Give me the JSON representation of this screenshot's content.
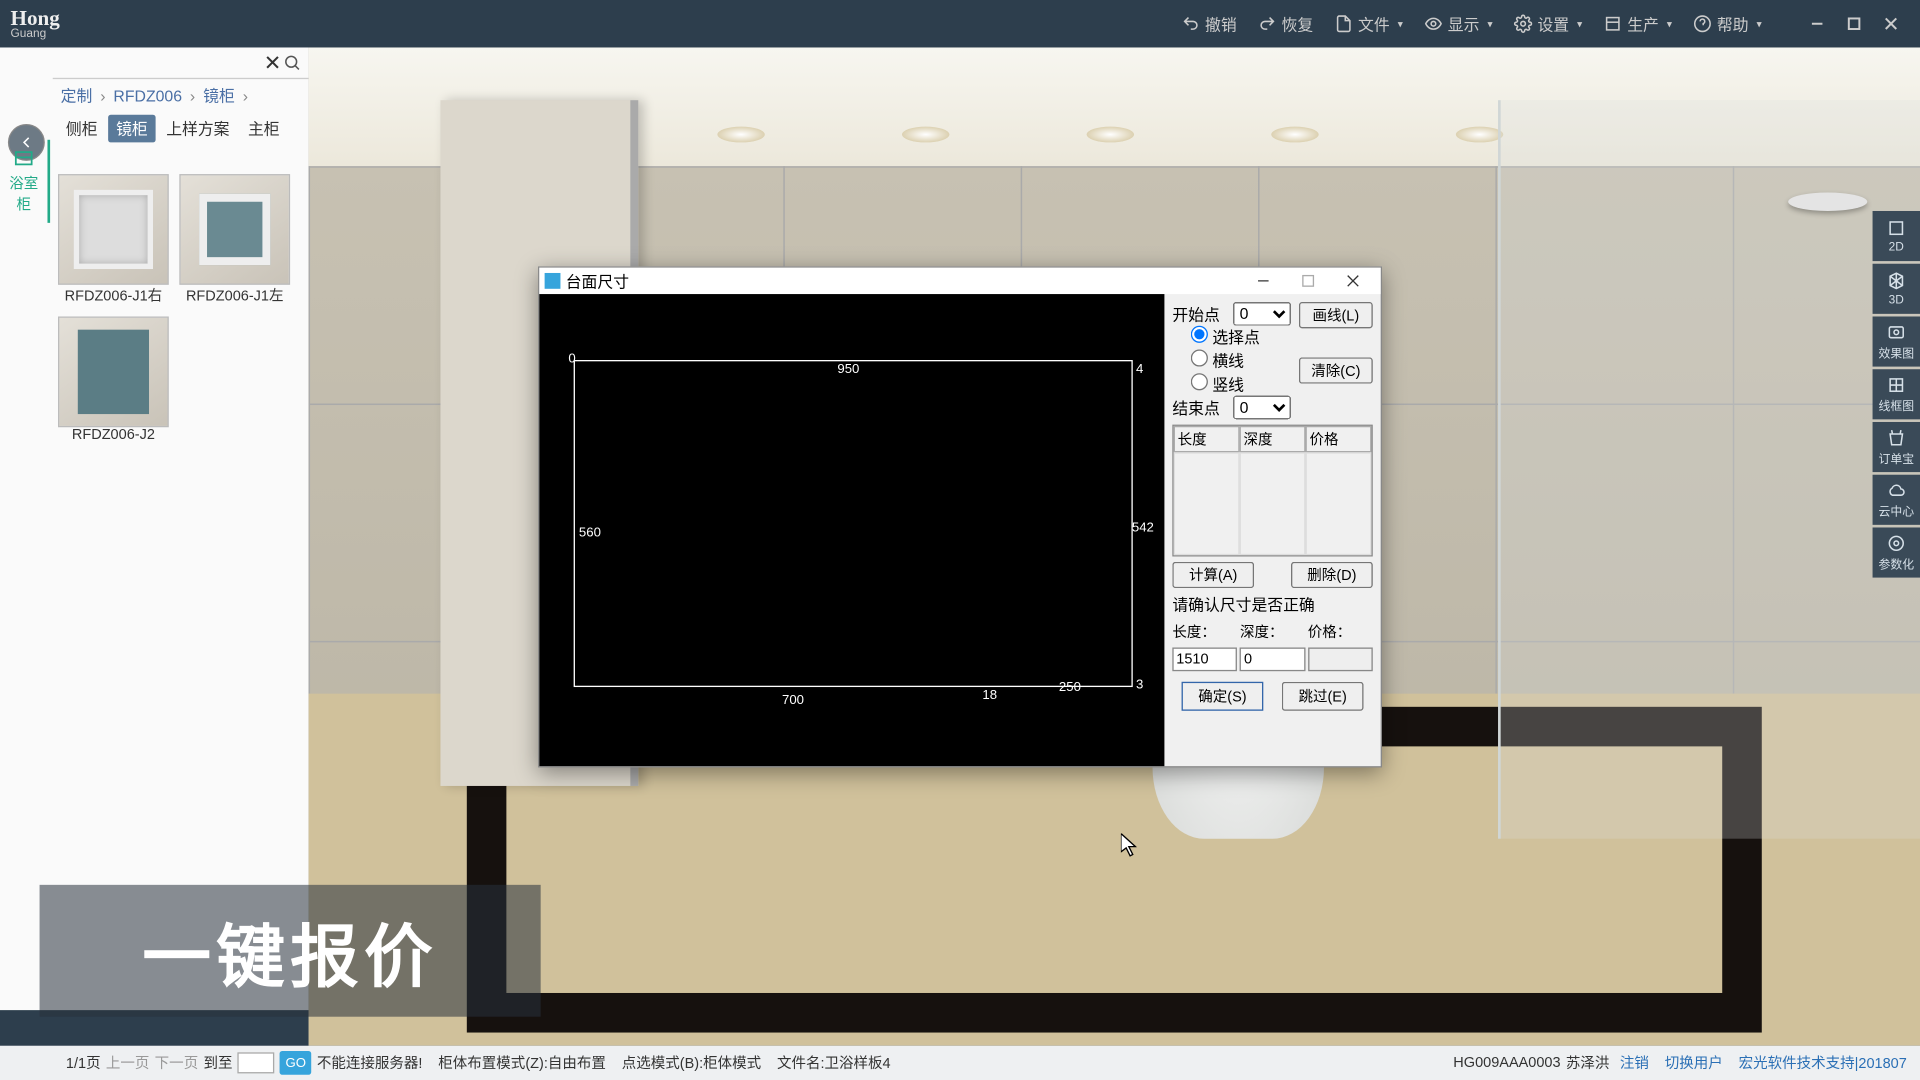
{
  "top": {
    "logo": "Hong",
    "logo_sub": "Guang",
    "undo": "撤销",
    "redo": "恢复",
    "file": "文件",
    "display": "显示",
    "settings": "设置",
    "produce": "生产",
    "help": "帮助"
  },
  "breadcrumb": {
    "a": "定制",
    "b": "RFDZ006",
    "c": "镜柜"
  },
  "tabs": {
    "a": "侧柜",
    "b": "镜柜",
    "c": "上样方案",
    "d": "主柜"
  },
  "cat": {
    "a": "浴室柜"
  },
  "search": {
    "placeholder": ""
  },
  "thumbs": {
    "t1": "RFDZ006-J1右",
    "t2": "RFDZ006-J1左",
    "t3": "RFDZ006-J2"
  },
  "right_tb": {
    "a": "2D",
    "b": "3D",
    "c": "效果图",
    "d": "线框图",
    "e": "订单宝",
    "f": "云中心",
    "g": "参数化"
  },
  "dialog": {
    "title": "台面尺寸",
    "start_label": "开始点",
    "start_val": "0",
    "radio_a": "选择点",
    "radio_b": "横线",
    "radio_c": "竖线",
    "end_label": "结束点",
    "end_val": "0",
    "btn_draw": "画线(L)",
    "btn_clear": "清除(C)",
    "col_len": "长度",
    "col_depth": "深度",
    "col_price": "价格",
    "btn_calc": "计算(A)",
    "btn_del": "删除(D)",
    "hint": "请确认尺寸是否正确",
    "len_label": "长度：",
    "depth_label": "深度：",
    "price_label": "价格：",
    "len_val": "1510",
    "depth_val": "0",
    "price_val": "",
    "ok": "确定(S)",
    "skip": "跳过(E)",
    "dims": {
      "top": "950",
      "left": "560",
      "right": "542",
      "right_edge": "4",
      "bl": "700",
      "bm": "18",
      "br": "250",
      "tl_mark": "0",
      "br_mark": "3"
    }
  },
  "promo": "一键报价",
  "status": {
    "page": "1/1页",
    "prev": "上一页",
    "next": "下一页",
    "goto": "到至",
    "go": "GO",
    "conn": "不能连接服务器!",
    "mode1": "柜体布置模式(Z):自由布置",
    "mode2": "点选模式(B):柜体模式",
    "file": "文件名:卫浴样板4",
    "user_id": "HG009AAA0003",
    "user_name": "苏泽洪",
    "logout": "注销",
    "switch": "切换用户",
    "support": "宏光软件技术支持|201807"
  }
}
